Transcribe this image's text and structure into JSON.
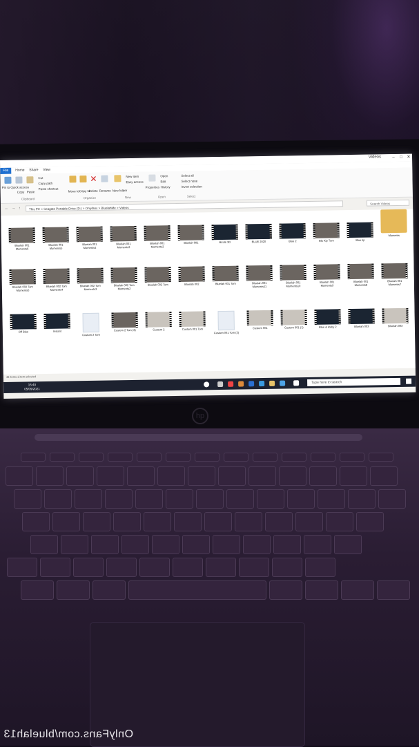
{
  "explorer": {
    "title": "Videos",
    "tabs": [
      "File",
      "Home",
      "Share",
      "View"
    ],
    "ribbon": {
      "clipboard": {
        "group": "Clipboard",
        "pin": "Pin to Quick access",
        "copy": "Copy",
        "paste": "Paste",
        "cut": "Cut",
        "copy_path": "Copy path",
        "paste_shortcut": "Paste shortcut"
      },
      "organize": {
        "group": "Organize",
        "move_to": "Move to",
        "copy_to": "Copy to",
        "delete": "Delete",
        "rename": "Rename"
      },
      "new": {
        "group": "New",
        "new_folder": "New folder",
        "new_item": "New item",
        "easy_access": "Easy access"
      },
      "open": {
        "group": "Open",
        "properties": "Properties",
        "open": "Open",
        "edit": "Edit",
        "history": "History"
      },
      "select": {
        "group": "Select",
        "select_all": "Select all",
        "select_none": "Select none",
        "invert_selection": "Invert selection"
      }
    },
    "address": "This PC  >  Seagate Portable Drive (D:)  >  Onlyfans  >  BluelahMe  >  Videos",
    "search_placeholder": "Search Videos",
    "rows": [
      [
        {
          "label": "Moments",
          "kind": "folder"
        },
        {
          "label": "Blue lip",
          "kind": "dark"
        },
        {
          "label": "Blu Kip Tum",
          "kind": "photo"
        },
        {
          "label": "Blue 2",
          "kind": "dark"
        },
        {
          "label": "BLUE 2020",
          "kind": "dark"
        },
        {
          "label": "BLUE 3D",
          "kind": "dark"
        },
        {
          "label": "Bluelah 001",
          "kind": "photo"
        },
        {
          "label": "Bluelah 001 Moments2",
          "kind": "photo"
        },
        {
          "label": "Bluelah 001 Moments3",
          "kind": "photo"
        },
        {
          "label": "Bluelah 001 Moments4",
          "kind": "photo"
        },
        {
          "label": "Bluelah 001 Moments5",
          "kind": "photo"
        },
        {
          "label": "Bluelah 001 Moments6",
          "kind": "photo"
        }
      ],
      [
        {
          "label": "Bluelah 001 Moments7",
          "kind": "photo"
        },
        {
          "label": "Bluelah 001 Moments8",
          "kind": "photo"
        },
        {
          "label": "Bluelah 001 Moments9",
          "kind": "photo"
        },
        {
          "label": "Bluelah 001 Moments10",
          "kind": "photo"
        },
        {
          "label": "Bluelah 001 Moments11",
          "kind": "photo"
        },
        {
          "label": "Bluelah 001 Tom",
          "kind": "photo"
        },
        {
          "label": "Bluelah 002",
          "kind": "photo"
        },
        {
          "label": "Bluelah 002 Tom",
          "kind": "photo"
        },
        {
          "label": "Bluelah 002 Tom Moments2",
          "kind": "photo"
        },
        {
          "label": "Bluelah 002 Tom Moments3",
          "kind": "photo"
        },
        {
          "label": "Bluelah 002 Tom Moments4",
          "kind": "photo"
        },
        {
          "label": "Bluelah 002 Tom Moments5",
          "kind": "photo"
        }
      ],
      [
        {
          "label": "Bluelah 003",
          "kind": "light"
        },
        {
          "label": "Bluelah 003",
          "kind": "dark"
        },
        {
          "label": "Blue & Ruby 2",
          "kind": "dark"
        },
        {
          "label": "Custom 001 (1)",
          "kind": "light"
        },
        {
          "label": "Custom 001",
          "kind": "light"
        },
        {
          "label": "Custom 001 Tom (2)",
          "kind": "doc"
        },
        {
          "label": "Custom 001 Tom",
          "kind": "light"
        },
        {
          "label": "Custom 2",
          "kind": "light"
        },
        {
          "label": "Custom 2 Tom (2)",
          "kind": "photo"
        },
        {
          "label": "Custom 2 Tom",
          "kind": "doc"
        },
        {
          "label": "Instant",
          "kind": "dark"
        },
        {
          "label": "Off Blue",
          "kind": "dark"
        }
      ]
    ],
    "status": "46 items   1 item selected",
    "taskbar": {
      "search_placeholder": "Type here to search",
      "time": "15:40",
      "date": "05/09/2021"
    }
  },
  "watermark": "OnlyFans.com/bluelah13",
  "brand": "hp"
}
